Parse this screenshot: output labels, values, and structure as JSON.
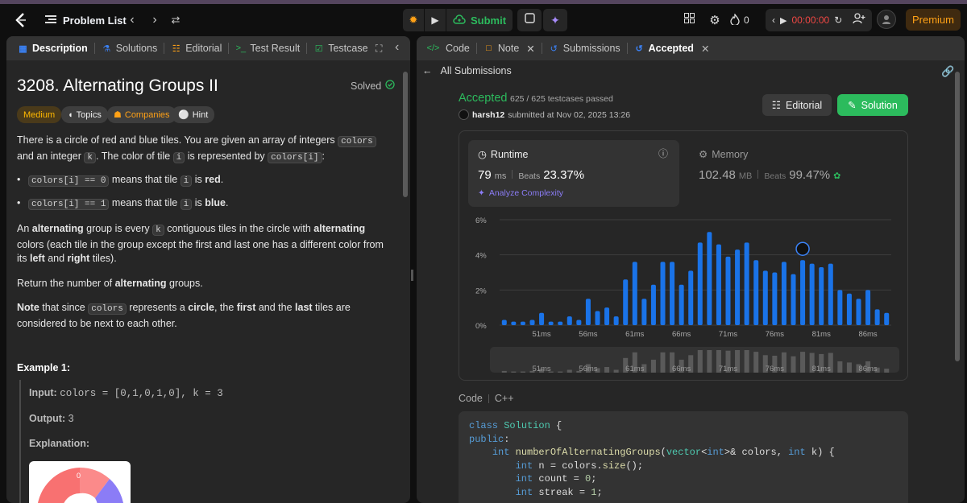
{
  "topbar": {
    "problem_list": "Problem List",
    "submit": "Submit",
    "streak_count": "0",
    "timer": "00:00:00",
    "premium": "Premium",
    "colors": {
      "accent": "#ffa116",
      "submit": "#2cbb5d",
      "timer": "#ef4743"
    }
  },
  "left_tabs": [
    "Description",
    "Solutions",
    "Editorial",
    "Test Result",
    "Testcase"
  ],
  "problem": {
    "title": "3208. Alternating Groups II",
    "status": "Solved",
    "difficulty": "Medium",
    "chips": [
      "Topics",
      "Companies",
      "Hint"
    ],
    "p1_a": "There is a circle of red and blue tiles. You are given an array of integers ",
    "p1_code": "colors",
    "p1_b": " and an integer ",
    "p1_k": "k",
    "p1_c": ". The color of tile ",
    "p1_i": "i",
    "p1_d": " is represented by ",
    "p1_ci": "colors[i]",
    "p1_e": ":",
    "b1_code": "colors[i] == 0",
    "b1_a": " means that tile ",
    "b1_i": "i",
    "b1_b": " is ",
    "b1_bold": "red",
    "b1_end": ".",
    "b2_code": "colors[i] == 1",
    "b2_a": " means that tile ",
    "b2_i": "i",
    "b2_b": " is ",
    "b2_bold": "blue",
    "b2_end": ".",
    "p2_a": "An ",
    "p2_b": "alternating",
    "p2_c": " group is every ",
    "p2_k": "k",
    "p2_d": " contiguous tiles in the circle with ",
    "p2_e": "alternating",
    "p2_f": " colors (each tile in the group except the first and last one has a different color from its ",
    "p2_g": "left",
    "p2_h": " and ",
    "p2_i": "right",
    "p2_j": " tiles).",
    "p3_a": "Return the number of ",
    "p3_b": "alternating",
    "p3_c": " groups.",
    "p4_a": "Note",
    "p4_b": " that since ",
    "p4_code": "colors",
    "p4_c": " represents a ",
    "p4_d": "circle",
    "p4_e": ", the ",
    "p4_f": "first",
    "p4_g": " and the ",
    "p4_h": "last",
    "p4_i": " tiles are considered to be next to each other.",
    "example_title": "Example 1:",
    "input_label": "Input:",
    "input_value": "colors = [0,1,0,1,0], k = 3",
    "output_label": "Output:",
    "output_value": "3",
    "explanation_label": "Explanation:",
    "figure_label": "0"
  },
  "right_tabs": [
    "Code",
    "Note",
    "Submissions",
    "Accepted"
  ],
  "submission": {
    "back": "All Submissions",
    "status": "Accepted",
    "testcases": "625 / 625 testcases passed",
    "user": "harsh12",
    "submitted": "submitted at Nov 02, 2025 13:26",
    "editorial_btn": "Editorial",
    "solution_btn": "Solution",
    "runtime_label": "Runtime",
    "runtime_value": "79",
    "runtime_unit": "ms",
    "beats_label": "Beats",
    "runtime_beats": "23.37%",
    "analyze": "Analyze Complexity",
    "memory_label": "Memory",
    "memory_value": "102.48",
    "memory_unit": "MB",
    "memory_beats": "99.47%",
    "code_label": "Code",
    "lang": "C++"
  },
  "code_lines": [
    "class Solution {",
    "public:",
    "    int numberOfAlternatingGroups(vector<int>& colors, int k) {",
    "        int n = colors.size();",
    "        int count = 0;",
    "        int streak = 1;"
  ],
  "chart_data": {
    "type": "bar",
    "ylim": [
      0,
      6
    ],
    "yticks": [
      "0%",
      "2%",
      "4%",
      "6%"
    ],
    "xticks": [
      "51ms",
      "56ms",
      "61ms",
      "66ms",
      "71ms",
      "76ms",
      "81ms",
      "86ms"
    ],
    "x": [
      47,
      48,
      49,
      50,
      51,
      52,
      53,
      54,
      55,
      56,
      57,
      58,
      59,
      60,
      61,
      62,
      63,
      64,
      65,
      66,
      67,
      68,
      69,
      70,
      71,
      72,
      73,
      74,
      75,
      76,
      77,
      78,
      79,
      80,
      81,
      82,
      83,
      84,
      85,
      86,
      87,
      88
    ],
    "values": [
      0.3,
      0.2,
      0.2,
      0.3,
      0.7,
      0.2,
      0.2,
      0.5,
      0.3,
      1.5,
      0.8,
      1.0,
      0.5,
      2.6,
      3.6,
      1.5,
      2.3,
      3.6,
      3.6,
      2.3,
      3.1,
      4.7,
      5.3,
      4.6,
      3.9,
      4.3,
      4.7,
      3.7,
      3.1,
      3.0,
      3.6,
      2.9,
      3.7,
      3.5,
      3.3,
      3.5,
      2.0,
      1.8,
      1.5,
      2.0,
      0.9,
      0.7
    ],
    "user_value_x": 79,
    "grid": true,
    "bar_color": "#1a73e8"
  }
}
